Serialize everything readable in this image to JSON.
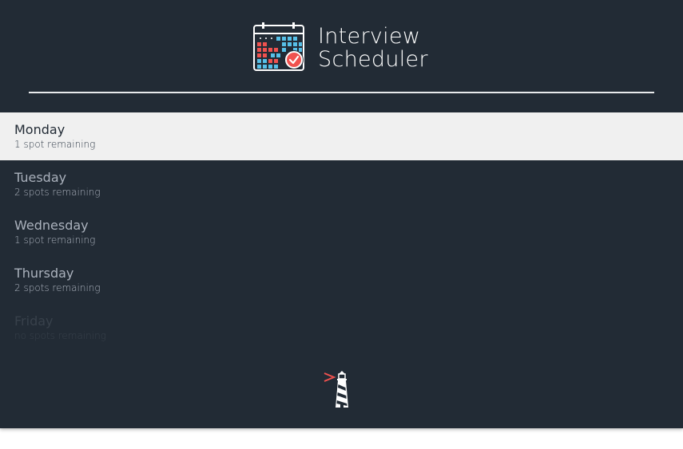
{
  "app": {
    "title_line1": "Interview",
    "title_line2": "Scheduler"
  },
  "days": [
    {
      "name": "Monday",
      "spots": "1 spot remaining",
      "state": "selected"
    },
    {
      "name": "Tuesday",
      "spots": "2 spots remaining",
      "state": "available"
    },
    {
      "name": "Wednesday",
      "spots": "1 spot remaining",
      "state": "available"
    },
    {
      "name": "Thursday",
      "spots": "2 spots remaining",
      "state": "available"
    },
    {
      "name": "Friday",
      "spots": "no spots remaining",
      "state": "full"
    }
  ],
  "icons": {
    "header": "calendar-check-icon",
    "footer": "lighthouse-icon"
  },
  "colors": {
    "background": "#222b35",
    "selected_background": "#f0f0f0",
    "accent": "#f0524f",
    "calendar_cells": "#57c0e8",
    "text_muted": "#aab1bc"
  }
}
